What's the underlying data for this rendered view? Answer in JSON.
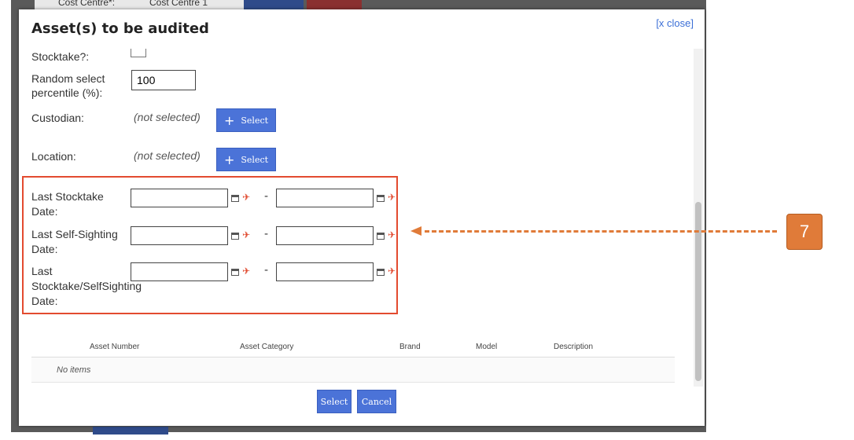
{
  "background": {
    "strip_labels": [
      "Cost Centre*:",
      "Cost Centre 1"
    ]
  },
  "modal": {
    "title": "Asset(s) to be audited",
    "close_label": "[x close]"
  },
  "form": {
    "stocktake_label": "Stocktake?:",
    "random_select_label_line1": "Random select",
    "random_select_label_line2": "percentile (%):",
    "random_select_value": "100",
    "custodian_label": "Custodian:",
    "custodian_value": "(not selected)",
    "location_label": "Location:",
    "location_value": "(not selected)",
    "select_button_label": "Select",
    "date_fields": [
      {
        "label_line1": "Last Stocktake",
        "label_line2": "Date:",
        "label_line3": ""
      },
      {
        "label_line1": "Last Self-Sighting",
        "label_line2": "Date:",
        "label_line3": ""
      },
      {
        "label_line1": "Last",
        "label_line2": "Stocktake/SelfSighting",
        "label_line3": "Date:"
      }
    ],
    "range_separator": "-"
  },
  "table": {
    "columns": [
      "Asset Number",
      "Asset Category",
      "Brand",
      "Model",
      "Description"
    ],
    "empty_text": "No items"
  },
  "footer": {
    "select_label": "Select",
    "cancel_label": "Cancel"
  },
  "annotation": {
    "callout_number": "7",
    "color": "#e07b39",
    "highlight_color": "#e34b2f"
  },
  "colors": {
    "button_blue": "#4b73d8",
    "link_blue": "#3a6ed6"
  }
}
